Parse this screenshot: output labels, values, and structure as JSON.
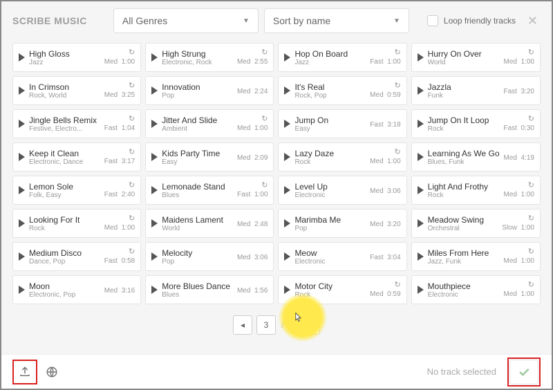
{
  "header": {
    "logo": "SCRIBE MUSIC",
    "genre_label": "All Genres",
    "sort_label": "Sort by name",
    "loop_label": "Loop friendly tracks"
  },
  "pager": {
    "current": "3",
    "total": "6"
  },
  "footer": {
    "status": "No track selected"
  },
  "tracks": [
    {
      "title": "High Gloss",
      "genre": "Jazz",
      "tempo": "Med",
      "dur": "1:00",
      "loop": true
    },
    {
      "title": "High Strung",
      "genre": "Electronic, Rock",
      "tempo": "Med",
      "dur": "2:55",
      "loop": true
    },
    {
      "title": "Hop On Board",
      "genre": "Jazz",
      "tempo": "Fast",
      "dur": "1:00",
      "loop": true
    },
    {
      "title": "Hurry On Over",
      "genre": "World",
      "tempo": "Med",
      "dur": "1:00",
      "loop": true
    },
    {
      "title": "In Crimson",
      "genre": "Rock, World",
      "tempo": "Med",
      "dur": "3:25",
      "loop": true
    },
    {
      "title": "Innovation",
      "genre": "Pop",
      "tempo": "Med",
      "dur": "2:24",
      "loop": false
    },
    {
      "title": "It's Real",
      "genre": "Rock, Pop",
      "tempo": "Med",
      "dur": "0:59",
      "loop": true
    },
    {
      "title": "Jazzla",
      "genre": "Funk",
      "tempo": "Fast",
      "dur": "3:20",
      "loop": false
    },
    {
      "title": "Jingle Bells Remix",
      "genre": "Festive, Electro...",
      "tempo": "Fast",
      "dur": "1:04",
      "loop": true
    },
    {
      "title": "Jitter And Slide",
      "genre": "Ambient",
      "tempo": "Med",
      "dur": "1:00",
      "loop": true
    },
    {
      "title": "Jump On",
      "genre": "Easy",
      "tempo": "Fast",
      "dur": "3:18",
      "loop": false
    },
    {
      "title": "Jump On It Loop",
      "genre": "Rock",
      "tempo": "Fast",
      "dur": "0:30",
      "loop": true
    },
    {
      "title": "Keep it Clean",
      "genre": "Electronic, Dance",
      "tempo": "Fast",
      "dur": "3:17",
      "loop": true
    },
    {
      "title": "Kids Party Time",
      "genre": "Easy",
      "tempo": "Med",
      "dur": "2:09",
      "loop": false
    },
    {
      "title": "Lazy Daze",
      "genre": "Rock",
      "tempo": "Med",
      "dur": "1:00",
      "loop": true
    },
    {
      "title": "Learning As We Go",
      "genre": "Blues, Funk",
      "tempo": "Med",
      "dur": "4:19",
      "loop": false
    },
    {
      "title": "Lemon Sole",
      "genre": "Folk, Easy",
      "tempo": "Fast",
      "dur": "2:40",
      "loop": true
    },
    {
      "title": "Lemonade Stand",
      "genre": "Blues",
      "tempo": "Fast",
      "dur": "1:00",
      "loop": true
    },
    {
      "title": "Level Up",
      "genre": "Electronic",
      "tempo": "Med",
      "dur": "3:06",
      "loop": false
    },
    {
      "title": "Light And Frothy",
      "genre": "Rock",
      "tempo": "Med",
      "dur": "1:00",
      "loop": true
    },
    {
      "title": "Looking For It",
      "genre": "Rock",
      "tempo": "Med",
      "dur": "1:00",
      "loop": true
    },
    {
      "title": "Maidens Lament",
      "genre": "World",
      "tempo": "Med",
      "dur": "2:48",
      "loop": false
    },
    {
      "title": "Marimba Me",
      "genre": "Pop",
      "tempo": "Med",
      "dur": "3:20",
      "loop": false
    },
    {
      "title": "Meadow Swing",
      "genre": "Orchestral",
      "tempo": "Slow",
      "dur": "1:00",
      "loop": true
    },
    {
      "title": "Medium Disco",
      "genre": "Dance, Pop",
      "tempo": "Fast",
      "dur": "0:58",
      "loop": true
    },
    {
      "title": "Melocity",
      "genre": "Pop",
      "tempo": "Med",
      "dur": "3:06",
      "loop": false
    },
    {
      "title": "Meow",
      "genre": "Electronic",
      "tempo": "Fast",
      "dur": "3:04",
      "loop": false
    },
    {
      "title": "Miles From Here",
      "genre": "Jazz, Funk",
      "tempo": "Med",
      "dur": "1:00",
      "loop": true
    },
    {
      "title": "Moon",
      "genre": "Electronic, Pop",
      "tempo": "Med",
      "dur": "3:16",
      "loop": false
    },
    {
      "title": "More Blues Dance",
      "genre": "Blues",
      "tempo": "Med",
      "dur": "1:56",
      "loop": false
    },
    {
      "title": "Motor City",
      "genre": "Rock",
      "tempo": "Med",
      "dur": "0:59",
      "loop": true
    },
    {
      "title": "Mouthpiece",
      "genre": "Electronic",
      "tempo": "Med",
      "dur": "1:00",
      "loop": true
    }
  ]
}
